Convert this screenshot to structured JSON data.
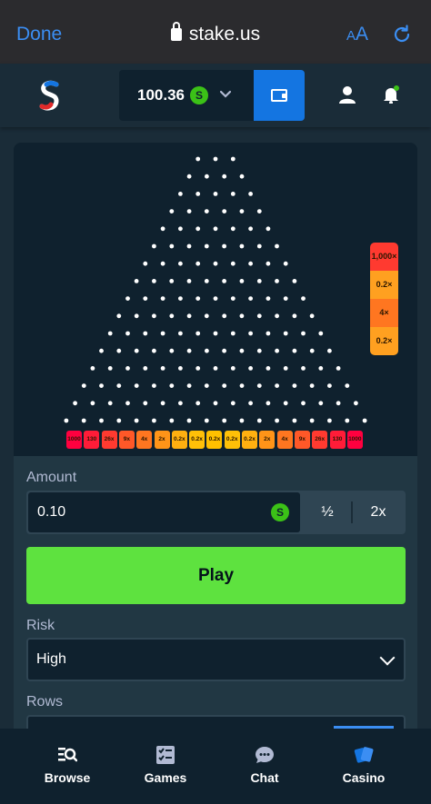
{
  "browser": {
    "done_label": "Done",
    "url": "stake.us",
    "text_size_small": "A",
    "text_size_large": "A"
  },
  "header": {
    "balance": "100.36",
    "currency_symbol": "S"
  },
  "plinko": {
    "peg_rows": 16,
    "bottom_multipliers": [
      "1000",
      "130",
      "26x",
      "9x",
      "4x",
      "2x",
      "0.2x",
      "0.2x",
      "0.2x",
      "0.2x",
      "0.2x",
      "2x",
      "4x",
      "9x",
      "26x",
      "130",
      "1000"
    ],
    "recent_results": [
      "1,000×",
      "0.2×",
      "4×",
      "0.2×"
    ]
  },
  "controls": {
    "amount_label": "Amount",
    "amount_value": "0.10",
    "amount_currency": "S",
    "half_label": "½",
    "double_label": "2x",
    "play_label": "Play",
    "risk_label": "Risk",
    "risk_value": "High",
    "rows_label": "Rows"
  },
  "bottom_nav": [
    {
      "label": "Browse",
      "icon": "browse-icon"
    },
    {
      "label": "Games",
      "icon": "games-icon"
    },
    {
      "label": "Chat",
      "icon": "chat-icon"
    },
    {
      "label": "Casino",
      "icon": "casino-icon"
    }
  ],
  "colors": {
    "accent_blue": "#1475e1",
    "play_green": "#5ee23f",
    "bg": "#1a2c38",
    "panel": "#0f212e"
  }
}
